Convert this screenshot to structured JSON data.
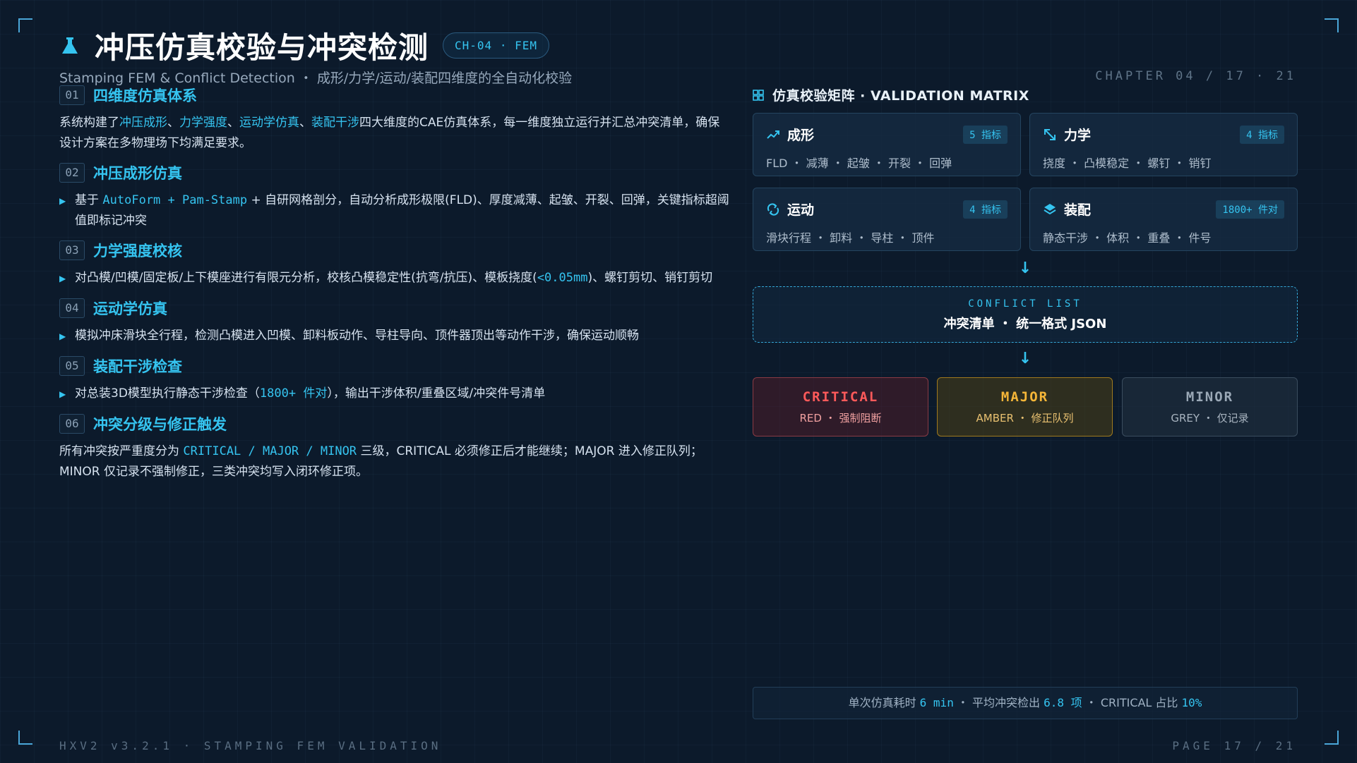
{
  "header": {
    "title": "冲压仿真校验与冲突检测",
    "chip": "CH-04 · FEM",
    "subtitle": "Stamping FEM & Conflict Detection ・ 成形/力学/运动/装配四维度的全自动化校验",
    "chapter": "CHAPTER 04 / 17 · 21"
  },
  "sections": [
    {
      "num": "01",
      "title": "四维度仿真体系",
      "text_a": "系统构建了",
      "hl1": "冲压成形",
      "sep1": "、",
      "hl2": "力学强度",
      "sep2": "、",
      "hl3": "运动学仿真",
      "sep3": "、",
      "hl4": "装配干涉",
      "text_b": "四大维度的CAE仿真体系，每一维度独立运行并汇总冲突清单，确保设计方案在多物理场下均满足要求。"
    },
    {
      "num": "02",
      "title": "冲压成形仿真",
      "pre": "基于 ",
      "code": "AutoForm + Pam-Stamp",
      "post": " + 自研网格剖分，自动分析成形极限(FLD)、厚度减薄、起皱、开裂、回弹，关键指标超阈值即标记冲突"
    },
    {
      "num": "03",
      "title": "力学强度校核",
      "pre": "对凸模/凹模/固定板/上下模座进行有限元分析，校核凸模稳定性(抗弯/抗压)、模板挠度(",
      "code": "<0.05mm",
      "post": ")、螺钉剪切、销钉剪切"
    },
    {
      "num": "04",
      "title": "运动学仿真",
      "text": "模拟冲床滑块全行程，检测凸模进入凹模、卸料板动作、导柱导向、顶件器顶出等动作干涉，确保运动顺畅"
    },
    {
      "num": "05",
      "title": "装配干涉检查",
      "pre": "对总装3D模型执行静态干涉检查（",
      "code": "1800+ 件对",
      "post": "），输出干涉体积/重叠区域/冲突件号清单"
    },
    {
      "num": "06",
      "title": "冲突分级与修正触发",
      "pre": "所有冲突按严重度分为 ",
      "code": "CRITICAL / MAJOR / MINOR",
      "post": " 三级，CRITICAL 必须修正后才能继续；MAJOR 进入修正队列；MINOR 仅记录不强制修正，三类冲突均写入闭环修正项。"
    }
  ],
  "matrix": {
    "title": "仿真校验矩阵 · VALIDATION MATRIX",
    "cards": [
      {
        "icon": "trend-line-icon",
        "name": "成形",
        "badge": "5 指标",
        "items": "FLD ・ 减薄 ・ 起皱 ・ 开裂 ・ 回弹"
      },
      {
        "icon": "resize-arrow-icon",
        "name": "力学",
        "badge": "4 指标",
        "items": "挠度 ・ 凸模稳定 ・ 螺钉 ・ 销钉"
      },
      {
        "icon": "rotate-icon",
        "name": "运动",
        "badge": "4 指标",
        "items": "滑块行程 ・ 卸料 ・ 导柱 ・ 顶件"
      },
      {
        "icon": "layers-icon",
        "name": "装配",
        "badge": "1800+ 件对",
        "items": "静态干涉 ・ 体积 ・ 重叠 ・ 件号"
      }
    ],
    "arrow": "↓",
    "conflict_label": "CONFLICT LIST",
    "conflict_text": "冲突清单 ・ 统一格式 JSON",
    "severities": [
      {
        "name": "CRITICAL",
        "desc": "RED ・ 强制阻断",
        "color": "#ff5a5a"
      },
      {
        "name": "MAJOR",
        "desc": "AMBER ・ 修正队列",
        "color": "#f5b638"
      },
      {
        "name": "MINOR",
        "desc": "GREY ・ 仅记录",
        "color": "#9aa8b6"
      }
    ]
  },
  "stats": {
    "t1": "单次仿真耗时 ",
    "v1": "6 min",
    "t2": " ・ 平均冲突检出 ",
    "v2": "6.8 项",
    "t3": " ・ CRITICAL 占比 ",
    "v3": "10%"
  },
  "footer": {
    "left": "HXV2 v3.2.1 · STAMPING FEM VALIDATION",
    "right": "PAGE 17 / 21"
  }
}
